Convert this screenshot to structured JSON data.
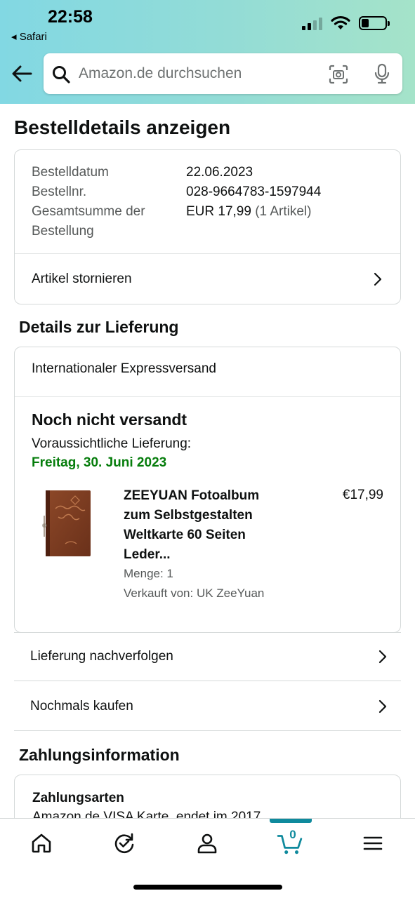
{
  "status_bar": {
    "time": "22:58",
    "back_app": "◂ Safari"
  },
  "search": {
    "placeholder": "Amazon.de durchsuchen"
  },
  "page": {
    "title": "Bestelldetails anzeigen"
  },
  "order": {
    "date_label": "Bestelldatum",
    "date_value": "22.06.2023",
    "number_label": "Bestellnr.",
    "number_value": "028-9664783-1597944",
    "total_label_line1": "Gesamtsumme der",
    "total_label_line2": "Bestellung",
    "total_value": "EUR 17,99",
    "total_items": "(1 Artikel)",
    "cancel_label": "Artikel stornieren"
  },
  "delivery": {
    "section_title": "Details zur Lieferung",
    "method": "Internationaler Expressversand",
    "status": "Noch nicht versandt",
    "expected_label": "Voraussichtliche Lieferung:",
    "expected_date": "Freitag, 30. Juni 2023",
    "product": {
      "title": "ZEEYUAN Fotoalbum zum Selbstgestalten Weltkarte 60 Seiten Leder...",
      "price": "€17,99",
      "quantity": "Menge: 1",
      "seller": "Verkauft von: UK ZeeYuan"
    },
    "track_label": "Lieferung nachverfolgen",
    "buy_again_label": "Nochmals kaufen"
  },
  "payment": {
    "section_title": "Zahlungsinformation",
    "heading": "Zahlungsarten",
    "detail": "Amazon.de VISA Karte, endet im 2017"
  },
  "tabbar": {
    "cart_count": "0",
    "active_tab": "cart"
  },
  "colors": {
    "accent_teal": "#0f8a9d",
    "delivery_green": "#067d0c",
    "header_gradient_start": "#82d8e3",
    "header_gradient_end": "#a5e3c9"
  }
}
